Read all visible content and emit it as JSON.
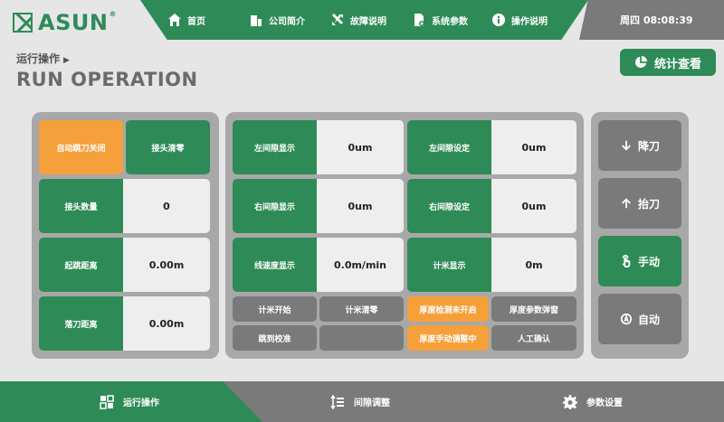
{
  "header": {
    "logo_text": "ASUN",
    "logo_reg": "®",
    "nav": [
      {
        "label": "首页",
        "icon": "home-icon"
      },
      {
        "label": "公司简介",
        "icon": "building-icon"
      },
      {
        "label": "故障说明",
        "icon": "tools-icon"
      },
      {
        "label": "系统参数",
        "icon": "document-gear-icon"
      },
      {
        "label": "操作说明",
        "icon": "info-icon"
      }
    ],
    "clock": "周四 08:08:39"
  },
  "page": {
    "subtitle": "运行操作",
    "subtitle_arrow": "▶",
    "title": "RUN OPERATION"
  },
  "stats_button": {
    "label": "统计查看",
    "icon": "pie-chart-icon"
  },
  "left_panel": {
    "auto_jump_label": "自动跳刀关闭",
    "joint_clear_label": "接头清零",
    "rows": [
      {
        "label": "接头数量",
        "value": "0"
      },
      {
        "label": "起跳距离",
        "value": "0.00m"
      },
      {
        "label": "落刀距离",
        "value": "0.00m"
      }
    ]
  },
  "mid_panel": {
    "rows": [
      {
        "label_a": "左间隙显示",
        "value_a": "0um",
        "label_b": "左间隙设定",
        "value_b": "0um"
      },
      {
        "label_a": "右间隙显示",
        "value_a": "0um",
        "label_b": "右间隙设定",
        "value_b": "0um"
      },
      {
        "label_a": "线速度显示",
        "value_a": "0.0m/min",
        "label_b": "计米显示",
        "value_b": "0m"
      }
    ],
    "buttons_row1": [
      "计米开始",
      "计米清零",
      "厚度检测未开启",
      "厚度参数弹窗"
    ],
    "buttons_row2": [
      "跳到校准",
      "",
      "厚度手动调整中",
      "人工确认"
    ]
  },
  "right_panel": {
    "buttons": [
      {
        "label": "降刀",
        "icon": "arrow-down-icon"
      },
      {
        "label": "抬刀",
        "icon": "arrow-up-icon"
      },
      {
        "label": "手动",
        "icon": "hand-icon"
      },
      {
        "label": "自动",
        "icon": "auto-icon"
      }
    ]
  },
  "bottom_nav": [
    {
      "label": "运行操作",
      "icon": "run-icon"
    },
    {
      "label": "间隙调整",
      "icon": "adjust-icon"
    },
    {
      "label": "参数设置",
      "icon": "gear-icon"
    }
  ],
  "colors": {
    "green": "#2e8b57",
    "orange": "#f6a03b",
    "gray": "#7a7a7a",
    "panel": "#a8a8a8",
    "background": "#e6e6e6"
  }
}
